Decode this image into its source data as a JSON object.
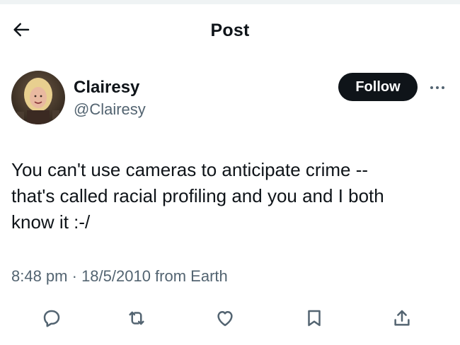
{
  "header": {
    "title": "Post",
    "back_icon": "arrow-left-icon"
  },
  "author": {
    "display_name": "Clairesy",
    "handle": "@Clairesy",
    "follow_label": "Follow",
    "more_icon": "more-dots-icon"
  },
  "post": {
    "text": "You can't use cameras to anticipate crime --\nthat's called racial profiling and you and I both\nknow it :-/",
    "time": "8:48 pm",
    "separator": " · ",
    "date": "18/5/2010",
    "source": " from Earth"
  },
  "actions": [
    {
      "icon": "reply-icon"
    },
    {
      "icon": "repost-icon"
    },
    {
      "icon": "like-icon"
    },
    {
      "icon": "bookmark-icon"
    },
    {
      "icon": "share-icon"
    }
  ],
  "colors": {
    "text_primary": "#0f1419",
    "text_secondary": "#536471",
    "button_bg": "#0f1419",
    "button_text": "#ffffff"
  }
}
